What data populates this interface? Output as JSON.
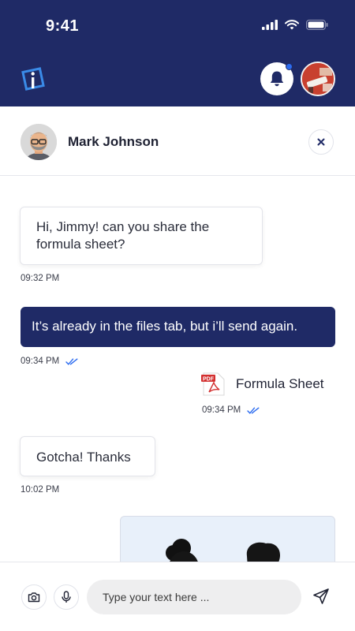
{
  "status_bar": {
    "time": "9:41"
  },
  "app_bar": {
    "logo_icon": "app-logo-icon",
    "notification_icon": "bell-icon",
    "has_unread_notification": true,
    "brand_color": "#1f2a66"
  },
  "chat_header": {
    "contact_name": "Mark Johnson",
    "close_icon": "close-icon"
  },
  "messages": [
    {
      "direction": "incoming",
      "text": "Hi, Jimmy! can you share the formula sheet?",
      "time": "09:32 PM"
    },
    {
      "direction": "outgoing",
      "text": "It’s already in the files tab, but i’ll send again.",
      "time": "09:34 PM",
      "status": "read"
    },
    {
      "direction": "outgoing",
      "type": "file",
      "file_label": "PDF",
      "file_name": "Formula Sheet",
      "time": "09:34 PM",
      "status": "read"
    },
    {
      "direction": "incoming",
      "text": "Gotcha! Thanks",
      "time": "10:02 PM"
    },
    {
      "direction": "outgoing",
      "type": "image"
    }
  ],
  "composer": {
    "placeholder": "Type your text here ...",
    "camera_icon": "camera-icon",
    "mic_icon": "microphone-icon",
    "send_icon": "send-icon"
  }
}
